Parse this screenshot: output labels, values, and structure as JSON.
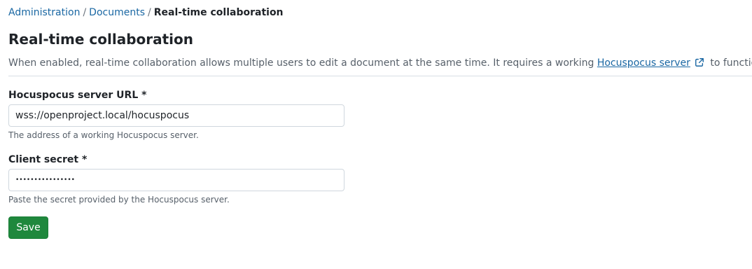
{
  "breadcrumb": {
    "items": [
      {
        "label": "Administration"
      },
      {
        "label": "Documents"
      }
    ],
    "separator": "/",
    "current": "Real-time collaboration"
  },
  "page": {
    "title": "Real-time collaboration",
    "description_before": "When enabled, real-time collaboration allows multiple users to edit a document at the same time. It requires a working ",
    "description_link": "Hocuspocus server",
    "description_link_icon": "external-link-icon",
    "description_after": " to function."
  },
  "form": {
    "server_url": {
      "label": "Hocuspocus server URL *",
      "value": "wss://openproject.local/hocuspocus",
      "hint": "The address of a working Hocuspocus server."
    },
    "client_secret": {
      "label": "Client secret *",
      "value": "••••••••••••••••",
      "hint": "Paste the secret provided by the Hocuspocus server."
    },
    "save_label": "Save"
  },
  "colors": {
    "link": "#1a67a3",
    "primary_button": "#1f883d",
    "muted_text": "#57606a",
    "border": "#d0d7de"
  }
}
